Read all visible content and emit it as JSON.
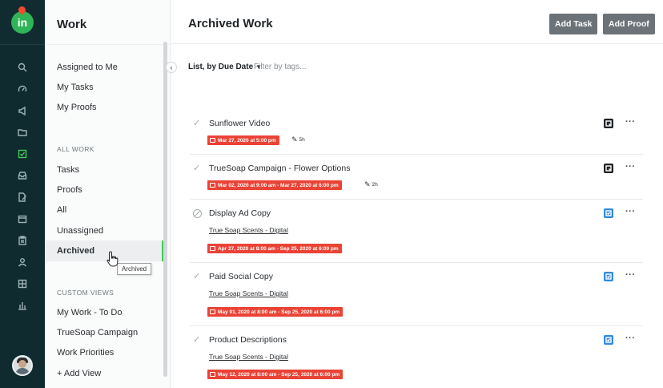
{
  "app": {
    "logo_text": "in",
    "colors": {
      "rail_bg": "#0f2b2f",
      "accent_green": "#44c95b",
      "date_red": "#ea4335",
      "task_blue": "#2f8be0",
      "button_gray": "#6b7378"
    }
  },
  "rail": {
    "icons": [
      "search-icon",
      "dashboard-gauge-icon",
      "megaphone-icon",
      "folder-icon",
      "work-check-icon",
      "inbox-icon",
      "file-edit-icon",
      "calendar-icon",
      "clipboard-icon",
      "user-icon",
      "grid-icon",
      "bar-chart-icon"
    ],
    "active_icon": "work-check-icon"
  },
  "sidebar": {
    "title": "Work",
    "top_items": [
      "Assigned to Me",
      "My Tasks",
      "My Proofs"
    ],
    "all_work_header": "ALL WORK",
    "all_work_items": [
      "Tasks",
      "Proofs",
      "All",
      "Unassigned",
      "Archived"
    ],
    "active_item": "Archived",
    "custom_views_header": "CUSTOM VIEWS",
    "custom_views_items": [
      "My Work - To Do",
      "TrueSoap Campaign",
      "Work Priorities"
    ],
    "add_view_label": "+ Add View",
    "tooltip": "Archived"
  },
  "main": {
    "title": "Archived Work",
    "add_task_label": "Add Task",
    "add_proof_label": "Add Proof",
    "view_label": "List, by Due Date",
    "filter_placeholder": "Filter by tags...",
    "tasks": [
      {
        "name": "Sunflower Video",
        "status": "done",
        "project": "",
        "date": "Mar 27, 2020 at 5:00 pm",
        "effort": "5h",
        "type": "proof"
      },
      {
        "name": "TrueSoap Campaign - Flower Options",
        "status": "done",
        "project": "",
        "date": "Mar 02, 2020 at 9:00 am - Mar 27, 2020 at 6:00 pm",
        "effort": "2h",
        "type": "proof"
      },
      {
        "name": "Display Ad Copy",
        "status": "cancelled",
        "project": "True Soap Scents - Digital",
        "date": "Apr 27, 2020 at 8:00 am - Sep 25, 2020 at 6:00 pm",
        "effort": "",
        "type": "task"
      },
      {
        "name": "Paid Social Copy",
        "status": "done",
        "project": "True Soap Scents - Digital",
        "date": "May 01, 2020 at 8:00 am - Sep 25, 2020 at 6:00 pm",
        "effort": "",
        "type": "task"
      },
      {
        "name": "Product Descriptions",
        "status": "done",
        "project": "True Soap Scents - Digital",
        "date": "May 12, 2020 at 8:00 am - Sep 25, 2020 at 6:00 pm",
        "effort": "",
        "type": "task"
      }
    ]
  }
}
